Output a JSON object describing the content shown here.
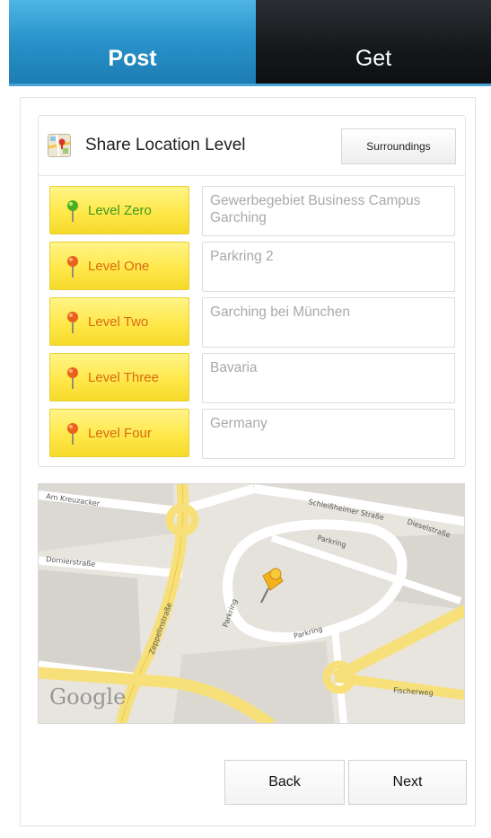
{
  "tabs": [
    {
      "label": "Post",
      "active": true
    },
    {
      "label": "Get",
      "active": false
    }
  ],
  "card": {
    "title": "Share Location Level",
    "icon": "map-icon",
    "surroundings_label": "Surroundings"
  },
  "levels": [
    {
      "label": "Level Zero",
      "pin_color": "#4caf1f",
      "value": "Gewerbegebiet Business Campus Garching"
    },
    {
      "label": "Level One",
      "pin_color": "#e8621c",
      "value": "Parkring 2"
    },
    {
      "label": "Level Two",
      "pin_color": "#e8621c",
      "value": "Garching bei München"
    },
    {
      "label": "Level Three",
      "pin_color": "#e8621c",
      "value": "Bavaria"
    },
    {
      "label": "Level Four",
      "pin_color": "#e8621c",
      "value": "Germany"
    }
  ],
  "map": {
    "logo": "Google",
    "marker_icon": "pushpin-icon",
    "streets": [
      "Parkring",
      "Schleißheimer Straße",
      "Dieselstraße",
      "Dornierstraße",
      "Zeppelinstraße",
      "Parkring",
      "Parkring",
      "Fischerweg",
      "Am Kreuzacker"
    ]
  },
  "nav": {
    "back_label": "Back",
    "next_label": "Next"
  },
  "colors": {
    "tab_active": "#2a94cb",
    "tab_inactive": "#15181b",
    "level_button": "#ffe84a",
    "level_text": "#d96a14",
    "level_zero_text": "#3e9a1f"
  }
}
